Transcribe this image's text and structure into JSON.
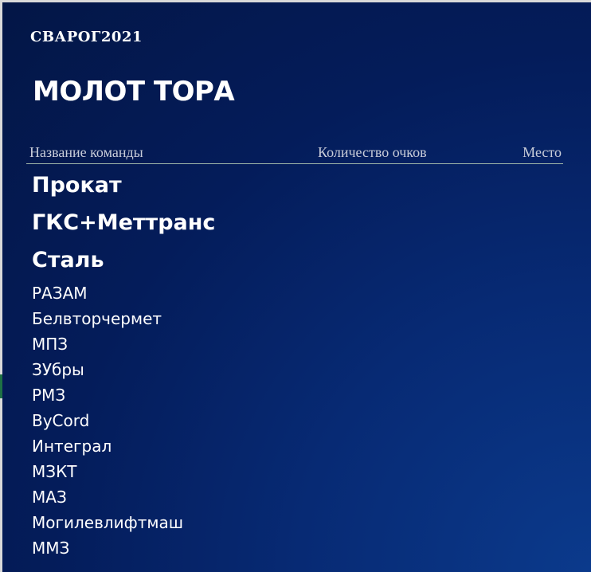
{
  "brand": "СВАРОГ2021",
  "title": "МОЛОТ ТОРА",
  "table": {
    "headers": {
      "name": "Название команды",
      "points": "Количество очков",
      "place": "Место"
    },
    "top_teams": [
      "Прокат",
      "ГКС+Меттранс",
      "Сталь"
    ],
    "teams": [
      "РАЗАМ",
      "Белвторчермет",
      "МПЗ",
      "ЗУбры",
      "РМЗ",
      "ByCord",
      "Интеграл",
      "МЗКТ",
      "МАЗ",
      "Могилевлифтмаш",
      "ММЗ"
    ]
  }
}
